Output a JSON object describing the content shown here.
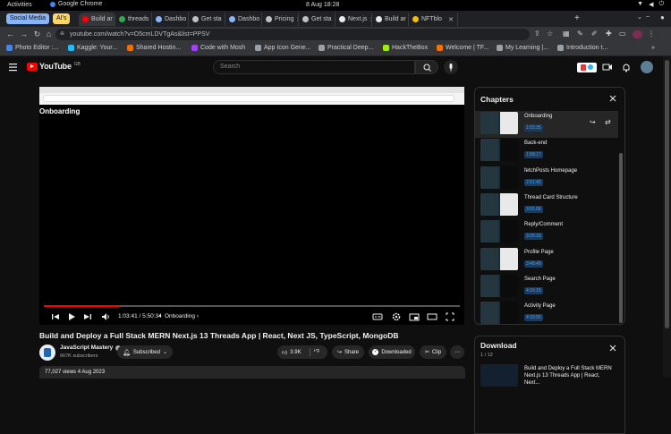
{
  "os": {
    "activities": "Activities",
    "app_name": "Google Chrome",
    "clock": "8 Aug  18:28"
  },
  "tabs": {
    "groups": [
      {
        "label": "Social Media",
        "color": "#8ab4f8"
      },
      {
        "label": "AI's",
        "color": "#fdd663"
      }
    ],
    "items": [
      {
        "label": "Build ar",
        "color": "#ff0000"
      },
      {
        "label": "threads",
        "color": "#34a853"
      },
      {
        "label": "Dashbo",
        "color": "#8ab4f8"
      },
      {
        "label": "Get sta",
        "color": "#bdc1c6"
      },
      {
        "label": "Dashbo",
        "color": "#8ab4f8"
      },
      {
        "label": "Pricing",
        "color": "#bdc1c6"
      },
      {
        "label": "Get sta",
        "color": "#bdc1c6"
      },
      {
        "label": "Next.js",
        "color": "#e8eaed"
      },
      {
        "label": "Build ar",
        "color": "#e8eaed"
      },
      {
        "label": "NFTblo",
        "color": "#fbbc04"
      }
    ]
  },
  "toolbar": {
    "url": "youtube.com/watch?v=O5cmLDVTgAs&list=PPSV"
  },
  "bookmarks": [
    {
      "label": "Photo Editor :...",
      "color": "#4285f4"
    },
    {
      "label": "Kaggle: Your...",
      "color": "#20beff"
    },
    {
      "label": "Shared Hostin...",
      "color": "#e8710a"
    },
    {
      "label": "Code with Mosh",
      "color": "#a142f4"
    },
    {
      "label": "App Icon Gene...",
      "color": "#9aa0a6"
    },
    {
      "label": "Practical Deep...",
      "color": "#9aa0a6"
    },
    {
      "label": "HackTheBox",
      "color": "#9fef00"
    },
    {
      "label": "Welcome | TF...",
      "color": "#ff6f00"
    },
    {
      "label": "My Learning |...",
      "color": "#9aa0a6"
    },
    {
      "label": "Introduction t...",
      "color": "#9aa0a6"
    }
  ],
  "youtube": {
    "logo": "YouTube",
    "country": "GB",
    "search_placeholder": "Search",
    "player": {
      "inner_heading": "Onboarding",
      "time": "1:03:41 / 5:50:34",
      "chapter_label": "Onboarding",
      "progress": 0.18
    },
    "video_title": "Build and Deploy a Full Stack MERN Next.js 13 Threads App | React, Next JS, TypeScript, MongoDB",
    "channel": {
      "name": "JavaScript Mastery",
      "subs": "667K subscribers"
    },
    "actions": {
      "subscribed": "Subscribed",
      "likes": "3.9K",
      "share": "Share",
      "downloaded": "Downloaded",
      "clip": "Clip"
    },
    "description": "77,027 views  4 Aug 2023",
    "chapters": {
      "title": "Chapters",
      "items": [
        {
          "title": "Onboarding",
          "time": "1:03:35",
          "thumb": "light"
        },
        {
          "title": "Back-end",
          "time": "1:58:17",
          "thumb": "dark"
        },
        {
          "title": "fetchPosts Homepage",
          "time": "2:51:42",
          "thumb": "dark"
        },
        {
          "title": "Thread Card Structure",
          "time": "3:01:06",
          "thumb": "light"
        },
        {
          "title": "Reply/Comment",
          "time": "3:25:33",
          "thumb": "dark"
        },
        {
          "title": "Profile Page",
          "time": "3:45:49",
          "thumb": "light"
        },
        {
          "title": "Search Page",
          "time": "4:16:15",
          "thumb": "dark"
        },
        {
          "title": "Activity Page",
          "time": "4:33:55",
          "thumb": "dark"
        }
      ]
    },
    "download": {
      "title": "Download",
      "count": "1 / 12",
      "item_title": "Build and Deploy a Full Stack MERN Next.js 13 Threads App | React, Next..."
    }
  }
}
